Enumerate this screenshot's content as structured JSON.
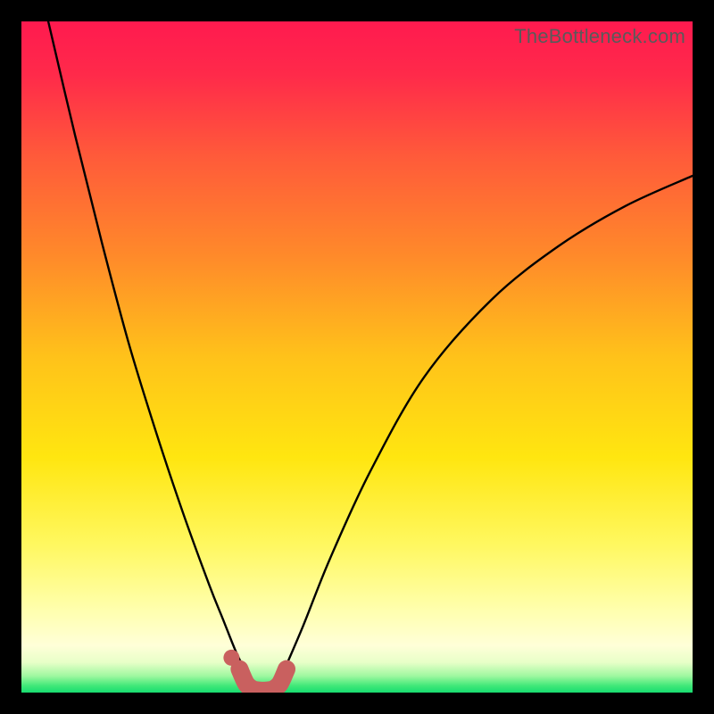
{
  "watermark": "TheBottleneck.com",
  "chart_data": {
    "type": "line",
    "title": "",
    "xlabel": "",
    "ylabel": "",
    "xlim": [
      0,
      100
    ],
    "ylim": [
      0,
      100
    ],
    "series": [
      {
        "name": "left-curve",
        "x": [
          4,
          8,
          12,
          16,
          20,
          24,
          28,
          30,
          32,
          33.5
        ],
        "values": [
          100,
          83,
          67,
          52,
          39,
          27,
          16,
          11,
          6,
          3
        ]
      },
      {
        "name": "right-curve",
        "x": [
          39,
          42,
          46,
          52,
          60,
          70,
          80,
          90,
          100
        ],
        "values": [
          3,
          10,
          20,
          33,
          47,
          58.5,
          66.5,
          72.5,
          77
        ]
      },
      {
        "name": "u-basin",
        "x": [
          32.5,
          33.5,
          34.5,
          35.5,
          36.5,
          37.5,
          38.5,
          39.5
        ],
        "values": [
          3.5,
          1.3,
          0.5,
          0.3,
          0.3,
          0.5,
          1.3,
          3.5
        ]
      }
    ],
    "markers": [
      {
        "name": "dot-left-of-basin",
        "x": 31.3,
        "y": 5.2
      }
    ],
    "gradient_stops": [
      {
        "offset": 0.0,
        "color": "#ff1a4f"
      },
      {
        "offset": 0.08,
        "color": "#ff2a4a"
      },
      {
        "offset": 0.2,
        "color": "#ff5a3a"
      },
      {
        "offset": 0.35,
        "color": "#ff8a2a"
      },
      {
        "offset": 0.5,
        "color": "#ffc21a"
      },
      {
        "offset": 0.65,
        "color": "#ffe610"
      },
      {
        "offset": 0.78,
        "color": "#fff860"
      },
      {
        "offset": 0.88,
        "color": "#ffffb0"
      },
      {
        "offset": 0.93,
        "color": "#ffffd8"
      },
      {
        "offset": 0.955,
        "color": "#e8ffc8"
      },
      {
        "offset": 0.975,
        "color": "#a0f8a0"
      },
      {
        "offset": 0.99,
        "color": "#40e878"
      },
      {
        "offset": 1.0,
        "color": "#18dc70"
      }
    ],
    "basin_color": "#c9605f",
    "curve_color": "#000000"
  }
}
